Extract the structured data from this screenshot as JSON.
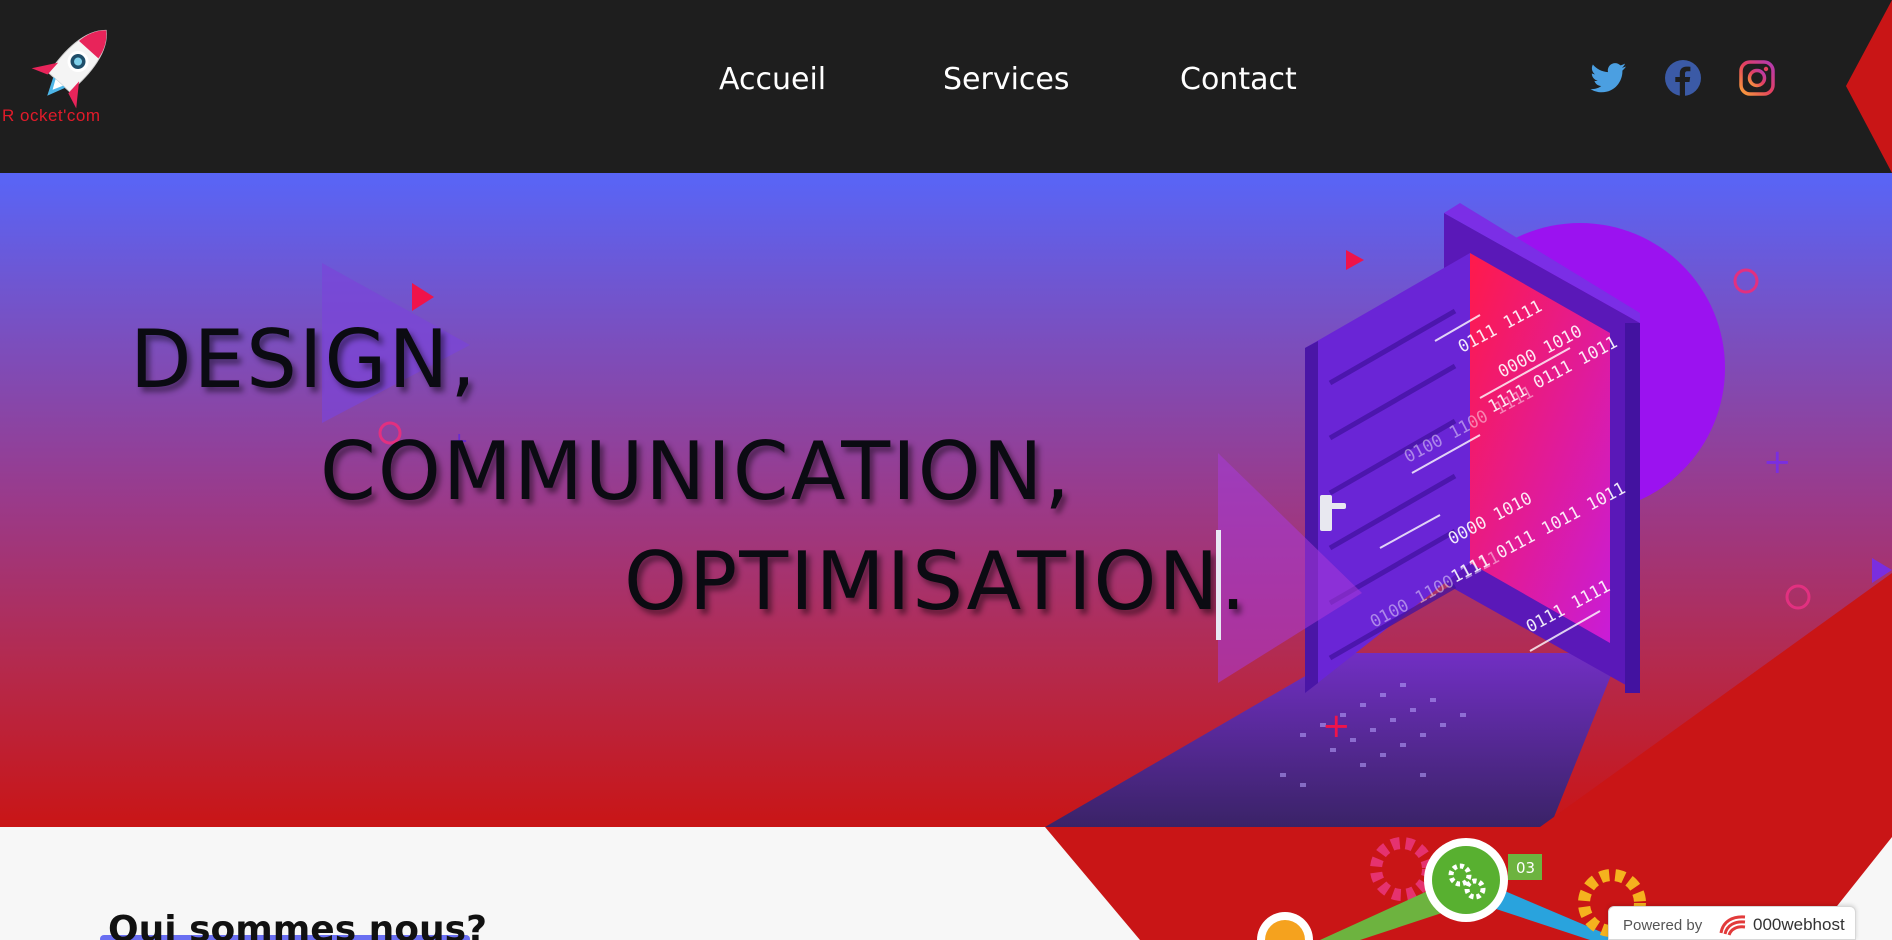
{
  "brand": {
    "logo_text": "R ocket'com"
  },
  "nav": {
    "links": [
      "Accueil",
      "Services",
      "Contact"
    ],
    "social": [
      "twitter-icon",
      "facebook-icon",
      "instagram-icon"
    ]
  },
  "hero": {
    "lines": [
      "DESIGN,",
      "COMMUNICATION,",
      "OPTIMISATION."
    ],
    "binary": [
      "0111 1111",
      "0000 1010",
      "1111 0111 1011",
      "0100 1100 1111",
      "0000 1010",
      "1111 0111 1011 1011",
      "0100 1100 1111",
      "0111 1111"
    ],
    "step_badge": "03"
  },
  "about": {
    "title": "Qui sommes nous?"
  },
  "badge": {
    "powered_by": "Powered by",
    "brand": "000webhost"
  },
  "colors": {
    "navbar": "#1e1e1e",
    "accent_red": "#c91516",
    "gradient_top": "#5865f7",
    "door_purple": "#6a25d6",
    "door_glow": "#ff1a5e"
  }
}
